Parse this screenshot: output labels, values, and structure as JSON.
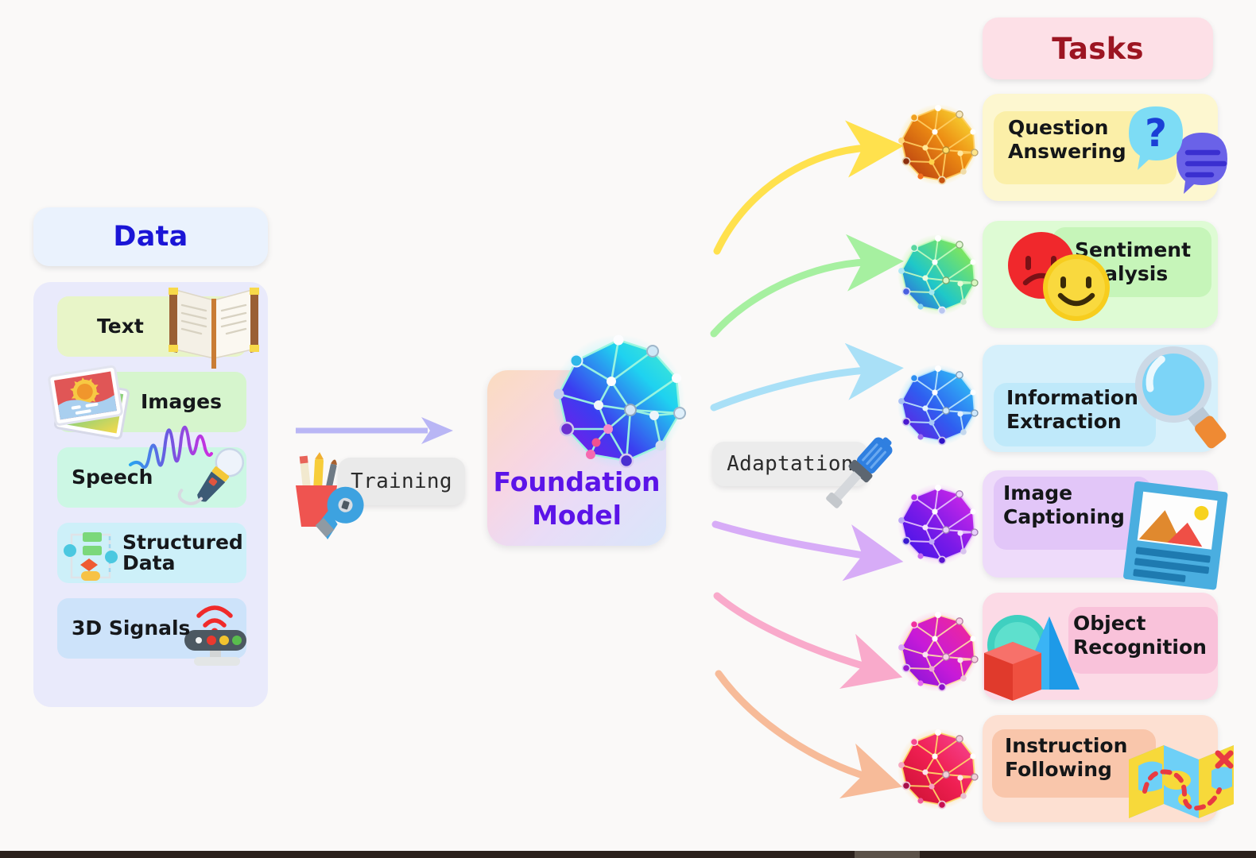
{
  "diagram": {
    "title_sections": {
      "data_header": "Data",
      "tasks_header": "Tasks"
    },
    "center": {
      "model_label": "Foundation\nModel",
      "model_accent_color": "#5b14e8"
    },
    "process_labels": {
      "training": "Training",
      "adaptation": "Adaptation"
    },
    "data": {
      "header": "Data",
      "header_bg": "#eaf2fd",
      "header_color": "#1a15d6",
      "panel_bg": "#e9eafb",
      "items": [
        {
          "label": "Text",
          "bg": "#e8f5c8",
          "icon": "open-book-icon"
        },
        {
          "label": "Images",
          "bg": "#d6f5cd",
          "icon": "photos-icon"
        },
        {
          "label": "Speech",
          "bg": "#ccf7e4",
          "icon": "microphone-waveform-icon"
        },
        {
          "label": "Structured\nData",
          "bg": "#cdf0f9",
          "icon": "flowchart-icon"
        },
        {
          "label": "3D Signals",
          "bg": "#cde3fa",
          "icon": "lidar-sensor-icon"
        }
      ]
    },
    "tasks": {
      "header": "Tasks",
      "header_bg": "#fde0e7",
      "header_color": "#9c1522",
      "items": [
        {
          "label": "Question\nAnswering",
          "outer_bg": "#fdf7d0",
          "inner_bg": "#fbefa8",
          "node_color": "#f2b705",
          "arrow_color": "#ffe14d",
          "icon": "question-chat-bubbles-icon"
        },
        {
          "label": "Sentiment\nAnalysis",
          "outer_bg": "#defbd4",
          "inner_bg": "#c6f5b9",
          "node_color": "#5bd92a",
          "arrow_color": "#a6f0a0",
          "icon": "sad-happy-faces-icon"
        },
        {
          "label": "Information\nExtraction",
          "outer_bg": "#d6f0fb",
          "inner_bg": "#bfe9fa",
          "node_color": "#2fa8f5",
          "arrow_color": "#a9e0f7",
          "icon": "magnifying-glass-icon"
        },
        {
          "label": "Image\nCaptioning",
          "outer_bg": "#eedbfa",
          "inner_bg": "#e2c6f8",
          "node_color": "#9a2ff0",
          "arrow_color": "#d7acf7",
          "icon": "picture-card-icon"
        },
        {
          "label": "Object\nRecognition",
          "outer_bg": "#fcdae6",
          "inner_bg": "#f9c2da",
          "node_color": "#ee2b8e",
          "arrow_color": "#f9aacb",
          "icon": "3d-shapes-icon"
        },
        {
          "label": "Instruction\nFollowing",
          "outer_bg": "#fde0d2",
          "inner_bg": "#f9c6ab",
          "node_color": "#f03c52",
          "arrow_color": "#f7bb99",
          "icon": "folded-map-icon"
        }
      ]
    },
    "arrows": {
      "training_arrow_color": "#b9b6f5",
      "adaptation_arrow_colors": [
        "#ffe14d",
        "#a6f0a0",
        "#a9e0f7",
        "#d7acf7",
        "#f9aacb",
        "#f7bb99"
      ]
    },
    "background_color": "#faf9f8"
  }
}
